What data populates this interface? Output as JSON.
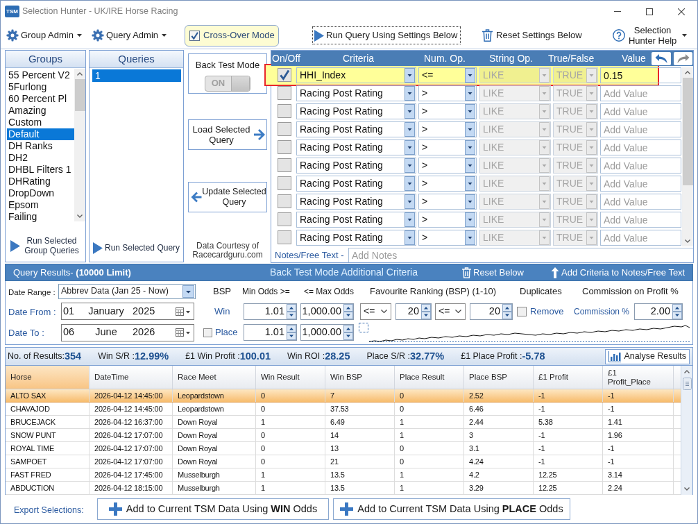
{
  "window": {
    "app_badge": "TSM",
    "title": "Selection Hunter - UK/IRE Horse Racing"
  },
  "toolbar": {
    "group_admin": "Group Admin",
    "query_admin": "Query Admin",
    "cross_over": {
      "label": "Cross-Over Mode",
      "checked": true
    },
    "run_query": "Run Query Using Settings Below",
    "reset_settings": "Reset Settings Below",
    "help": "Selection Hunter Help"
  },
  "groups": {
    "title": "Groups",
    "items": [
      {
        "label": "55 Percent V2",
        "selected": false
      },
      {
        "label": "5Furlong",
        "selected": false
      },
      {
        "label": "60 Percent Pl",
        "selected": false
      },
      {
        "label": "Amazing",
        "selected": false
      },
      {
        "label": "Custom",
        "selected": false
      },
      {
        "label": "Default",
        "selected": true
      },
      {
        "label": "DH Ranks",
        "selected": false
      },
      {
        "label": "DH2",
        "selected": false
      },
      {
        "label": "DHBL Filters 1",
        "selected": false
      },
      {
        "label": "DHRating",
        "selected": false
      },
      {
        "label": "DropDown",
        "selected": false
      },
      {
        "label": "Epsom",
        "selected": false
      },
      {
        "label": "Failing",
        "selected": false
      }
    ],
    "run_button": "Run Selected Group Queries"
  },
  "queries": {
    "title": "Queries",
    "items": [
      {
        "label": "1",
        "selected": true
      }
    ],
    "run_button": "Run Selected Query"
  },
  "back_test": {
    "title": "Back Test Mode",
    "toggle": {
      "label": "ON",
      "on": true
    }
  },
  "load_button": "Load Selected Query",
  "update_button": "Update Selected Query",
  "credit": "Data Courtesy of Racecardguru.com",
  "criteria": {
    "columns": [
      "On/Off",
      "Criteria",
      "Num. Op.",
      "String Op.",
      "True/False",
      "Value"
    ],
    "rows": [
      {
        "checked": true,
        "highlight": true,
        "criteria": "HHI_Index",
        "num_op": "<=",
        "string_op": {
          "text": "LIKE",
          "disabled": true
        },
        "true_false": {
          "text": "TRUE",
          "disabled": true
        },
        "value": "0.15"
      },
      {
        "checked": false,
        "highlight": false,
        "criteria": "Racing Post Rating",
        "num_op": ">",
        "string_op": {
          "text": "LIKE",
          "disabled": true
        },
        "true_false": {
          "text": "TRUE",
          "disabled": true
        },
        "placeholder": "Add Value"
      },
      {
        "checked": false,
        "highlight": false,
        "criteria": "Racing Post Rating",
        "num_op": ">",
        "string_op": {
          "text": "LIKE",
          "disabled": true
        },
        "true_false": {
          "text": "TRUE",
          "disabled": true
        },
        "placeholder": "Add Value"
      },
      {
        "checked": false,
        "highlight": false,
        "criteria": "Racing Post Rating",
        "num_op": ">",
        "string_op": {
          "text": "LIKE",
          "disabled": true
        },
        "true_false": {
          "text": "TRUE",
          "disabled": true
        },
        "placeholder": "Add Value"
      },
      {
        "checked": false,
        "highlight": false,
        "criteria": "Racing Post Rating",
        "num_op": ">",
        "string_op": {
          "text": "LIKE",
          "disabled": true
        },
        "true_false": {
          "text": "TRUE",
          "disabled": true
        },
        "placeholder": "Add Value"
      },
      {
        "checked": false,
        "highlight": false,
        "criteria": "Racing Post Rating",
        "num_op": ">",
        "string_op": {
          "text": "LIKE",
          "disabled": true
        },
        "true_false": {
          "text": "TRUE",
          "disabled": true
        },
        "placeholder": "Add Value"
      },
      {
        "checked": false,
        "highlight": false,
        "criteria": "Racing Post Rating",
        "num_op": ">",
        "string_op": {
          "text": "LIKE",
          "disabled": true
        },
        "true_false": {
          "text": "TRUE",
          "disabled": true
        },
        "placeholder": "Add Value"
      },
      {
        "checked": false,
        "highlight": false,
        "criteria": "Racing Post Rating",
        "num_op": ">",
        "string_op": {
          "text": "LIKE",
          "disabled": true
        },
        "true_false": {
          "text": "TRUE",
          "disabled": true
        },
        "placeholder": "Add Value"
      },
      {
        "checked": false,
        "highlight": false,
        "criteria": "Racing Post Rating",
        "num_op": ">",
        "string_op": {
          "text": "LIKE",
          "disabled": true
        },
        "true_false": {
          "text": "TRUE",
          "disabled": true
        },
        "placeholder": "Add Value"
      },
      {
        "checked": false,
        "highlight": false,
        "criteria": "Racing Post Rating",
        "num_op": ">",
        "string_op": {
          "text": "LIKE",
          "disabled": true
        },
        "true_false": {
          "text": "TRUE",
          "disabled": true
        },
        "placeholder": "Add Value"
      }
    ],
    "notes": {
      "label": "Notes/Free Text -",
      "placeholder": "Add Notes"
    }
  },
  "query_results": {
    "title": "Query Results- **(10000 Limit)**",
    "subtitle": "Back Test Mode Additional Criteria",
    "reset": "Reset Below",
    "add_criteria": "Add Criteria to Notes/Free Text"
  },
  "filters": {
    "date_range": {
      "label": "Date Range :",
      "value": "Abbrev Data (Jan 25 - Now)"
    },
    "date_from": {
      "label": "Date From :",
      "day": "01",
      "month": "January",
      "year": "2025"
    },
    "date_to": {
      "label": "Date To :",
      "day": "06",
      "month": "June",
      "year": "2026"
    },
    "bsp": {
      "title": "BSP",
      "win": "Win",
      "place": {
        "label": "Place",
        "checked": false
      }
    },
    "min_odds": {
      "title": "Min Odds >=",
      "win": "1.01",
      "place": "1.01"
    },
    "max_odds": {
      "title": "<= Max Odds",
      "win": "1,000.00",
      "place": "1,000.00"
    },
    "favourite": {
      "title": "Favourite Ranking (BSP) (1-10)",
      "op1": "<=",
      "value1": "20",
      "op2": "<=",
      "value2": "20"
    },
    "duplicates": {
      "title": "Duplicates",
      "label": "Remove",
      "checked": false
    },
    "commission": {
      "title": "Commission on Profit %",
      "label": "Commission %",
      "value": "2.00"
    }
  },
  "summary": {
    "stats": [
      {
        "label": "No. of Results:",
        "value": "354"
      },
      {
        "label": "Win S/R :",
        "value": "12.99%"
      },
      {
        "label": "£1 Win Profit :",
        "value": "100.01"
      },
      {
        "label": "Win ROI :",
        "value": "28.25"
      },
      {
        "label": "Place S/R :",
        "value": "32.77%"
      },
      {
        "label": "£1 Place Profit :",
        "value": "-5.78"
      }
    ],
    "analyse_button": "Analyse Results"
  },
  "table": {
    "columns": [
      {
        "label": "Horse",
        "sorted": true
      },
      {
        "label": "DateTime",
        "sorted": false
      },
      {
        "label": "Race Meet",
        "sorted": false
      },
      {
        "label": "Win Result",
        "sorted": false
      },
      {
        "label": "Win BSP",
        "sorted": false
      },
      {
        "label": "Place Result",
        "sorted": false
      },
      {
        "label": "Place BSP",
        "sorted": false
      },
      {
        "label": "£1 Profit",
        "sorted": false
      },
      {
        "label": "£1 Profit_Place",
        "sorted": false
      }
    ],
    "rows": [
      {
        "selected": true,
        "cells": [
          "ALTO SAX",
          "2026-04-12 14:45:00",
          "Leopardstown",
          "0",
          "7",
          "0",
          "2.52",
          "-1",
          "-1"
        ]
      },
      {
        "selected": false,
        "cells": [
          "CHAVAJOD",
          "2026-04-12 14:45:00",
          "Leopardstown",
          "0",
          "37.53",
          "0",
          "6.46",
          "-1",
          "-1"
        ]
      },
      {
        "selected": false,
        "cells": [
          "BRUCEJACK",
          "2026-04-12 16:37:00",
          "Down Royal",
          "1",
          "6.49",
          "1",
          "2.44",
          "5.38",
          "1.41"
        ]
      },
      {
        "selected": false,
        "cells": [
          "SNOW PUNT",
          "2026-04-12 17:07:00",
          "Down Royal",
          "0",
          "14",
          "1",
          "3",
          "-1",
          "1.96"
        ]
      },
      {
        "selected": false,
        "cells": [
          "ROYAL TIME",
          "2026-04-12 17:07:00",
          "Down Royal",
          "0",
          "13",
          "0",
          "3.1",
          "-1",
          "-1"
        ]
      },
      {
        "selected": false,
        "cells": [
          "SAMPOET",
          "2026-04-12 17:07:00",
          "Down Royal",
          "0",
          "21",
          "0",
          "4.24",
          "-1",
          "-1"
        ]
      },
      {
        "selected": false,
        "cells": [
          "FAST FRED",
          "2026-04-12 17:45:00",
          "Musselburgh",
          "1",
          "13.5",
          "1",
          "4.2",
          "12.25",
          "3.14"
        ]
      },
      {
        "selected": false,
        "cells": [
          "ABDUCTION",
          "2026-04-12 18:15:00",
          "Musselburgh",
          "1",
          "13.5",
          "1",
          "3.29",
          "12.25",
          "2.24"
        ]
      }
    ]
  },
  "export": {
    "label": "Export Selections:",
    "buttons": [
      "Add to Current TSM Data Using **WIN** Odds",
      "Add to Current TSM Data Using **PLACE** Odds"
    ]
  }
}
